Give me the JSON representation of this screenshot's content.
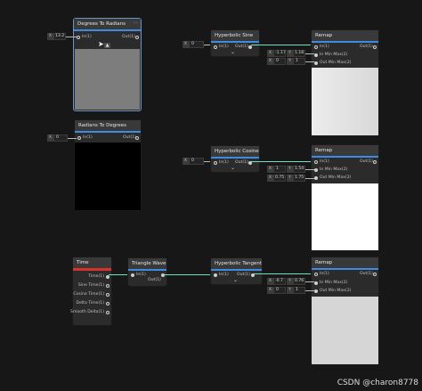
{
  "nodes": {
    "deg_to_rad": {
      "title": "Degrees To Radians",
      "in_label": "In(1)",
      "out_label": "Out(1)",
      "input_axis": "X",
      "input_value": "13.2",
      "overflow_icon": "ellipsis-icon",
      "preview_toggle": "chevron-up-icon"
    },
    "rad_to_deg": {
      "title": "Radians To Degrees",
      "in_label": "In(1)",
      "out_label": "Out(1)",
      "input_axis": "X",
      "input_value": "0"
    },
    "hyp_sine": {
      "title": "Hyperbolic Sine",
      "in_label": "In(1)",
      "out_label": "Out(1)",
      "input_axis": "X",
      "input_value": "0"
    },
    "hyp_cosine": {
      "title": "Hyperbolic Cosine",
      "in_label": "In(1)",
      "out_label": "Out(1)",
      "input_axis": "X",
      "input_value": "0"
    },
    "hyp_tangent": {
      "title": "Hyperbolic Tangent",
      "in_label": "In(1)",
      "out_label": "Out(1)"
    },
    "triangle_wave": {
      "title": "Triangle Wave",
      "in_label": "In(1)",
      "out_label": "Out(1)"
    },
    "time": {
      "title": "Time",
      "outputs": [
        "Time(1)",
        "Sine Time(1)",
        "Cosine Time(1)",
        "Delta Time(1)",
        "Smooth Delta(1)"
      ]
    },
    "remap1": {
      "title": "Remap",
      "ports": [
        "In(1)",
        "In Min Max(2)",
        "Out Min Max(2)"
      ],
      "out_label": "Out(1)",
      "inmin_x_axis": "X",
      "inmin_x": "-1.17",
      "inmin_y_axis": "Y",
      "inmin_y": "1.18",
      "outmin_x_axis": "X",
      "outmin_x": "0",
      "outmin_y_axis": "Y",
      "outmin_y": "1"
    },
    "remap2": {
      "title": "Remap",
      "ports": [
        "In(1)",
        "In Min Max(2)",
        "Out Min Max(2)"
      ],
      "out_label": "Out(1)",
      "inmin_x_axis": "X",
      "inmin_x": "1",
      "inmin_y_axis": "Y",
      "inmin_y": "1.54",
      "outmin_x_axis": "X",
      "outmin_x": "0.75",
      "outmin_y_axis": "Y",
      "outmin_y": "1.75"
    },
    "remap3": {
      "title": "Remap",
      "ports": [
        "In(1)",
        "In Min Max(2)",
        "Out Min Max(2)"
      ],
      "out_label": "Out(1)",
      "inmin_x_axis": "X",
      "inmin_x": "-0.7",
      "inmin_y_axis": "Y",
      "inmin_y": "0.76",
      "outmin_x_axis": "X",
      "outmin_x": "0",
      "outmin_y_axis": "Y",
      "outmin_y": "1"
    }
  },
  "expand_icon": "chevron-down-icon",
  "watermark": "CSDN @charon8778",
  "colors": {
    "accent": "#3e8be4",
    "time_bar": "#d8322c",
    "wire_float": "#6ee0c6",
    "wire_vec2": "#b9b9b9"
  }
}
